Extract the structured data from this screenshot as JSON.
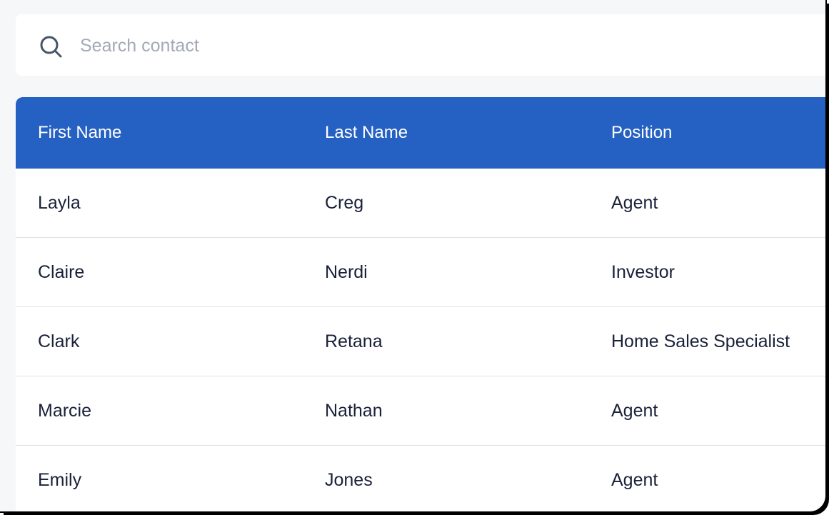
{
  "search": {
    "placeholder": "Search contact",
    "value": ""
  },
  "table": {
    "columns": [
      "First Name",
      "Last Name",
      "Position"
    ],
    "rows": [
      [
        "Layla",
        "Creg",
        "Agent"
      ],
      [
        "Claire",
        "Nerdi",
        "Investor"
      ],
      [
        "Clark",
        "Retana",
        "Home Sales Specialist"
      ],
      [
        "Marcie",
        "Nathan",
        "Agent"
      ],
      [
        "Emily",
        "Jones",
        "Agent"
      ]
    ]
  },
  "colors": {
    "header_bg": "#2561c2",
    "page_bg": "#f6f7f9",
    "text": "#1a2138",
    "placeholder": "#a4a9b6"
  },
  "icons": {
    "search": "search-icon"
  }
}
